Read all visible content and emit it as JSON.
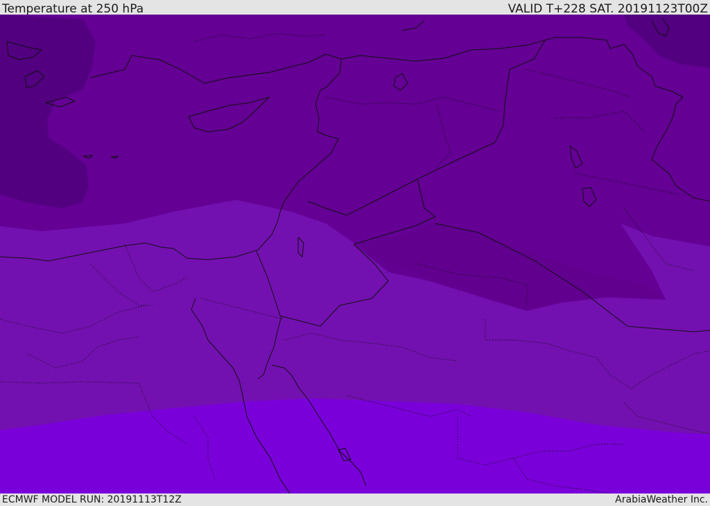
{
  "header": {
    "title": "Temperature at 250 hPa",
    "valid": "VALID T+228 SAT. 20191123T00Z"
  },
  "footer": {
    "model_run": "ECMWF MODEL RUN: 20191113T12Z",
    "credit": "ArabiaWeather Inc."
  },
  "colors": {
    "band_coldest": "#520080",
    "band_cold": "#640094",
    "band_mid": "#7310b0",
    "band_warm": "#7a00da",
    "borders": "#111111",
    "frame": "#e4e4e4"
  }
}
